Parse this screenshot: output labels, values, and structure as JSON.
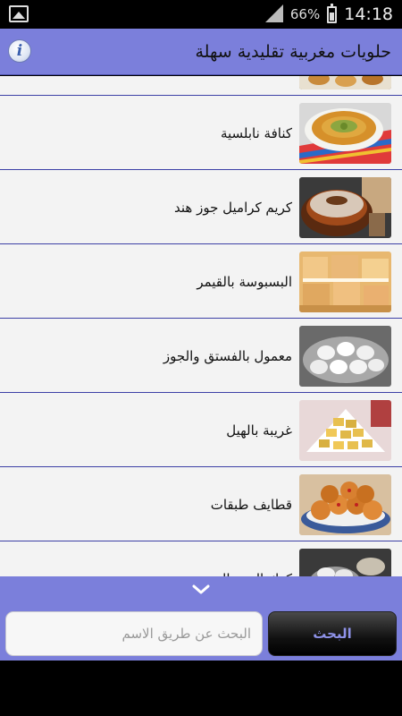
{
  "status_bar": {
    "battery_percent": "66%",
    "time": "14:18",
    "icons": [
      "gallery-icon",
      "signal-icon",
      "battery-icon"
    ]
  },
  "header": {
    "title": "حلويات مغربية تقليدية سهلة",
    "info_icon": "info-icon",
    "info_glyph": "i"
  },
  "list": {
    "items": [
      {
        "label": "",
        "thumb": "partial-dessert"
      },
      {
        "label": "كنافة نابلسية",
        "thumb": "kunafa"
      },
      {
        "label": "كريم كراميل جوز هند",
        "thumb": "caramel-cake"
      },
      {
        "label": "البسبوسة بالقيمر",
        "thumb": "basbousa"
      },
      {
        "label": "معمول بالفستق والجوز",
        "thumb": "maamoul"
      },
      {
        "label": "غريبة بالهيل",
        "thumb": "ghriba"
      },
      {
        "label": "قطايف طبقات",
        "thumb": "qatayef"
      },
      {
        "label": "كعك العيد بالعجوة",
        "thumb": "kaak"
      }
    ]
  },
  "search": {
    "placeholder": "البحث عن طريق الاسم",
    "value": "",
    "button_label": "البحث"
  },
  "colors": {
    "accent": "#7b7fdb",
    "divider": "#3c40a6",
    "list_bg": "#f3f3f3",
    "search_button_text": "#8e92e8"
  }
}
